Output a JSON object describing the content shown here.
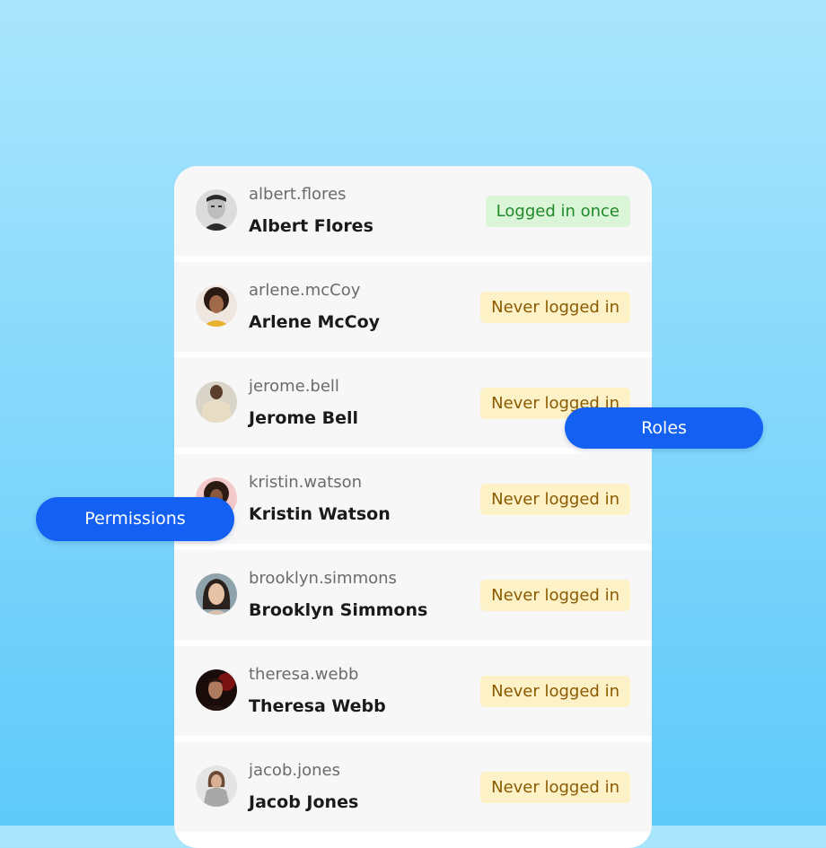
{
  "users": [
    {
      "username": "albert.flores",
      "name": "Albert Flores",
      "status": "Logged in once"
    },
    {
      "username": "arlene.mcCoy",
      "name": "Arlene McCoy",
      "status": "Never logged in"
    },
    {
      "username": "jerome.bell",
      "name": "Jerome Bell",
      "status": "Never logged in"
    },
    {
      "username": "kristin.watson",
      "name": "Kristin Watson",
      "status": "Never logged in"
    },
    {
      "username": "brooklyn.simmons",
      "name": "Brooklyn Simmons",
      "status": "Never logged in"
    },
    {
      "username": "theresa.webb",
      "name": "Theresa Webb",
      "status": "Never logged in"
    },
    {
      "username": "jacob.jones",
      "name": "Jacob Jones",
      "status": "Never logged in"
    }
  ],
  "tags": {
    "roles": "Roles",
    "permissions": "Permissions"
  },
  "colors": {
    "accent": "#1360f2",
    "logged_once_bg": "#dbf5d9",
    "logged_once_text": "#1f8a2a",
    "never_bg": "#fdf1c7",
    "never_text": "#8a5a00"
  }
}
